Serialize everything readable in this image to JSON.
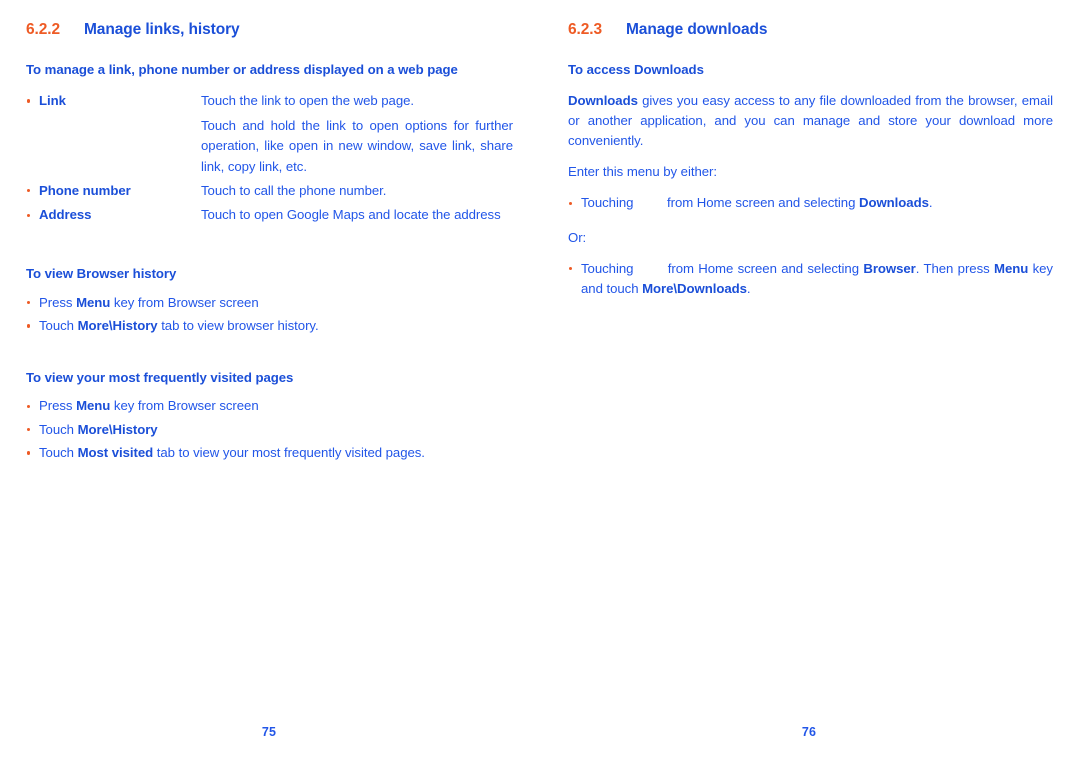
{
  "document": {
    "colors": {
      "section_number": "#EE5B25",
      "heading_blue": "#1B4FD8",
      "body_blue": "#2256E8",
      "bullet_orange": "#EE5B25",
      "background": "#FFFFFF"
    }
  },
  "left_page": {
    "section": {
      "number": "6.2.2",
      "title": "Manage links, history"
    },
    "subsection_1": {
      "heading": "To manage a link, phone number or address displayed on a web page",
      "definitions": [
        {
          "term": "Link",
          "definition": "Touch the link to open the web page.",
          "continuation": "Touch and hold the link to open options for further operation, like open in new window, save link, share link, copy link, etc."
        },
        {
          "term": "Phone number",
          "definition": "Touch to call the phone number.",
          "continuation": ""
        },
        {
          "term": "Address",
          "definition": "Touch to open Google Maps and locate the address",
          "continuation": ""
        }
      ]
    },
    "subsection_2": {
      "heading": "To view Browser history",
      "bullets": [
        {
          "pre": "Press ",
          "bold": "Menu",
          "post": " key from Browser screen"
        },
        {
          "pre": "Touch ",
          "bold": "More\\History",
          "post": " tab to view browser history."
        }
      ]
    },
    "subsection_3": {
      "heading": "To view your most frequently visited pages",
      "bullets": [
        {
          "pre": "Press ",
          "bold": "Menu",
          "post": " key from Browser screen"
        },
        {
          "pre": "Touch ",
          "bold": "More\\History",
          "post": ""
        },
        {
          "pre": "Touch ",
          "bold": "Most visited",
          "post": " tab to view your most frequently visited pages."
        }
      ]
    },
    "folio": "75"
  },
  "right_page": {
    "section": {
      "number": "6.2.3",
      "title": "Manage downloads"
    },
    "subsection_1": {
      "heading": "To access Downloads",
      "paragraph": {
        "bold_lead": "Downloads",
        "text": " gives you easy access to any file downloaded from the browser, email or another application, and you can manage and store your download more conveniently."
      },
      "intro": "Enter this menu by either:",
      "bullet_1": {
        "pre": "Touching ",
        "post_pre": "from Home screen and selecting ",
        "bold": "Downloads",
        "post": "."
      },
      "or_label": "Or:",
      "bullet_2": {
        "pre": "Touching ",
        "post_pre": "from Home screen and selecting ",
        "bold_1": "Browser",
        "mid": ". Then press ",
        "bold_2": "Menu",
        "mid_2": " key and touch ",
        "bold_3": "More\\Downloads",
        "post": "."
      }
    },
    "folio": "76"
  }
}
